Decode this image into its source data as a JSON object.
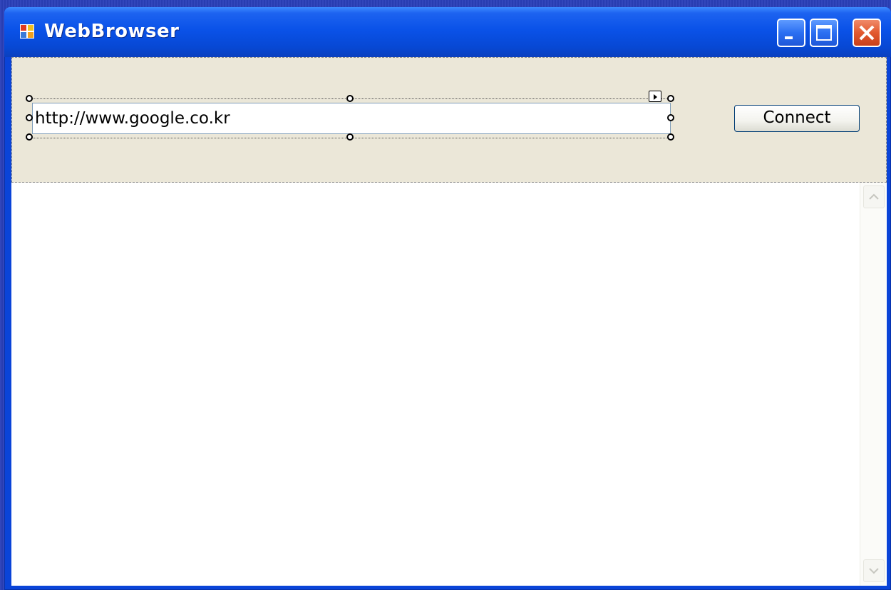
{
  "window": {
    "title": "WebBrowser",
    "icon": "app-window-icon",
    "controls": [
      "minimize-icon",
      "maximize-icon",
      "close-icon"
    ]
  },
  "panel": {
    "url_input_value": "http://www.google.co.kr",
    "connect_label": "Connect"
  },
  "colors": {
    "titlebar": "#0a52e8",
    "panel": "#ebe7d8",
    "close_button": "#e2592f"
  }
}
